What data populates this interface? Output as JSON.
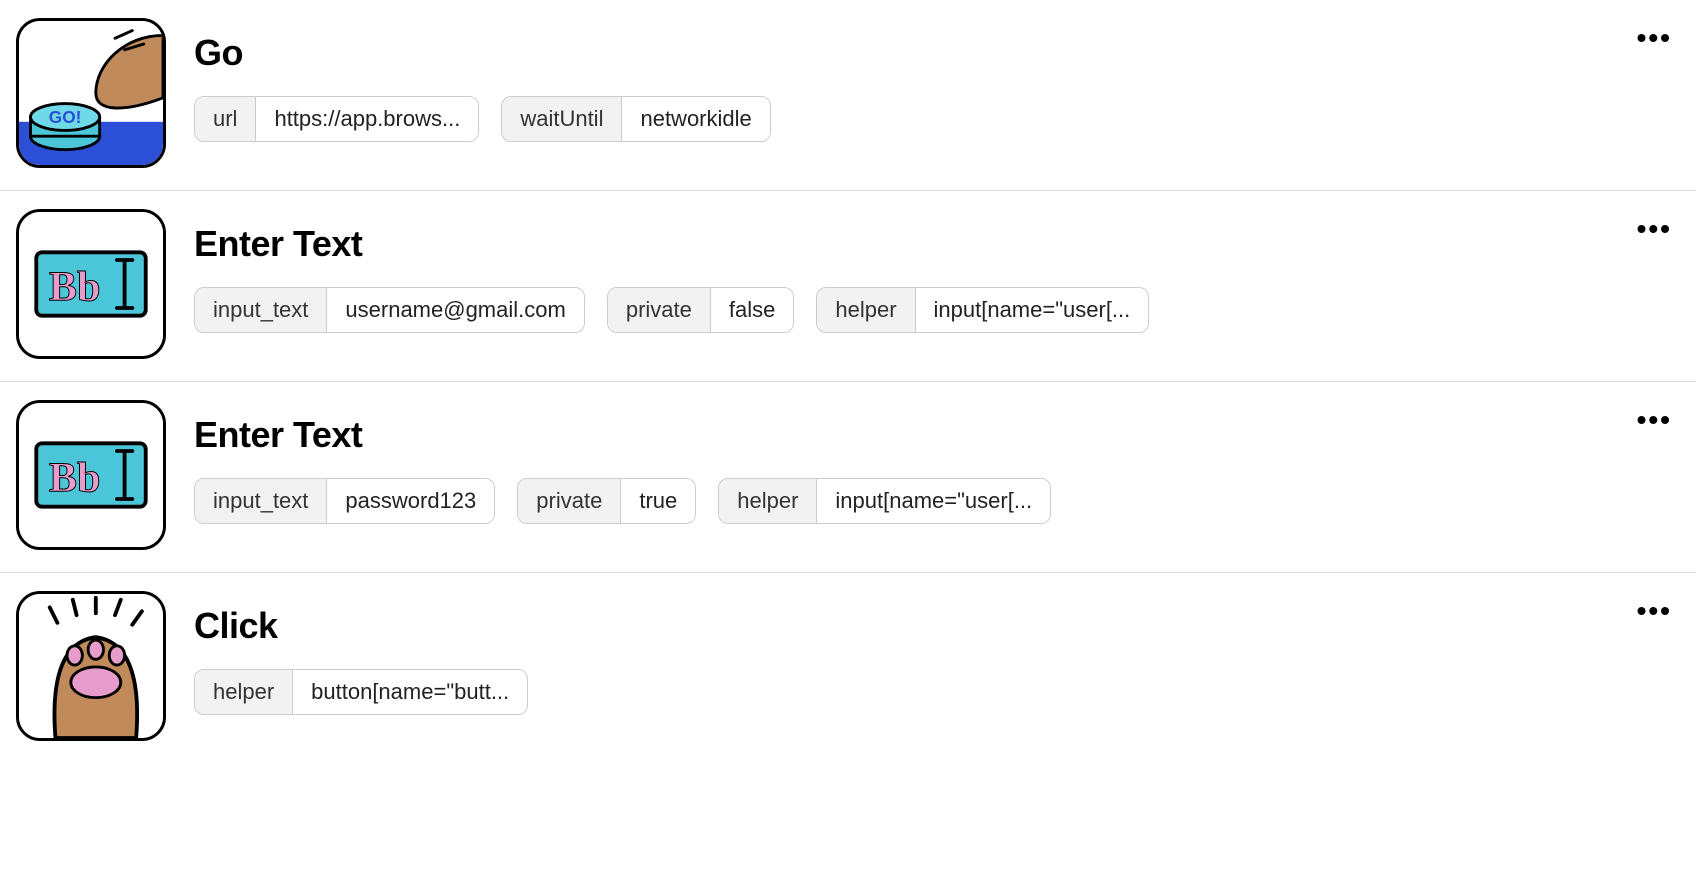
{
  "steps": [
    {
      "title": "Go",
      "icon": "go",
      "params": [
        {
          "key": "url",
          "value": "https://app.brows..."
        },
        {
          "key": "waitUntil",
          "value": "networkidle"
        }
      ]
    },
    {
      "title": "Enter Text",
      "icon": "enter-text",
      "params": [
        {
          "key": "input_text",
          "value": "username@gmail.com"
        },
        {
          "key": "private",
          "value": "false"
        },
        {
          "key": "helper",
          "value": "input[name=\"user[..."
        }
      ]
    },
    {
      "title": "Enter Text",
      "icon": "enter-text",
      "params": [
        {
          "key": "input_text",
          "value": "password123"
        },
        {
          "key": "private",
          "value": "true"
        },
        {
          "key": "helper",
          "value": "input[name=\"user[..."
        }
      ]
    },
    {
      "title": "Click",
      "icon": "click",
      "params": [
        {
          "key": "helper",
          "value": "button[name=\"butt..."
        }
      ]
    }
  ],
  "more_glyph": "•••"
}
